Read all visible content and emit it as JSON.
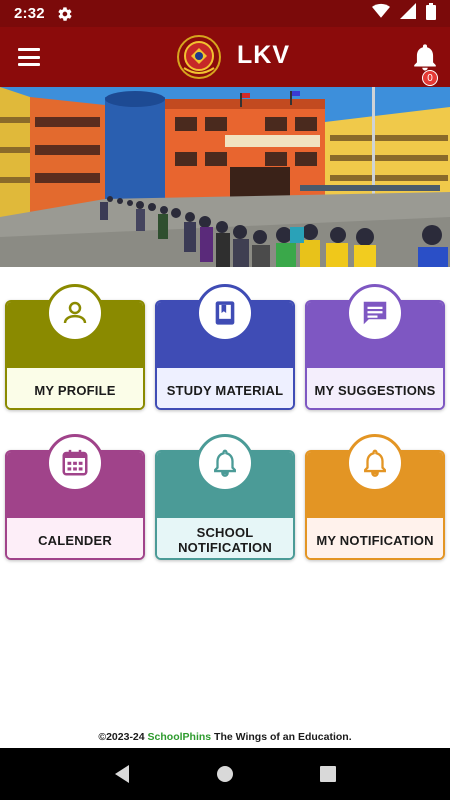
{
  "status_bar": {
    "time": "2:32",
    "icons": [
      "gear-icon",
      "wifi-icon",
      "signal-icon",
      "battery-icon"
    ]
  },
  "app_bar": {
    "title": "LKV",
    "menu_icon": "hamburger-menu-icon",
    "notification_icon": "bell-icon",
    "notification_count": "0",
    "background_color": "#8b0b0b"
  },
  "hero": {
    "description_icon": "school-building-photo"
  },
  "tiles": [
    {
      "label": "MY PROFILE",
      "icon": "person-icon",
      "accent": "#8a8a00",
      "bottom_bg": "#fbfde8"
    },
    {
      "label": "STUDY MATERIAL",
      "icon": "book-icon",
      "accent": "#3f4cb5",
      "bottom_bg": "#eef0ff"
    },
    {
      "label": "MY SUGGESTIONS",
      "icon": "chat-icon",
      "accent": "#7e57c2",
      "bottom_bg": "#f4eefc"
    },
    {
      "label": "CALENDER",
      "icon": "calendar-icon",
      "accent": "#a0438a",
      "bottom_bg": "#fdeef8"
    },
    {
      "label_line1": "SCHOOL",
      "label_line2": "NOTIFICATION",
      "icon": "bell-icon",
      "accent": "#4b9b97",
      "bottom_bg": "#e6f6f7"
    },
    {
      "label": "MY NOTIFICATION",
      "icon": "bell-icon",
      "accent": "#e39524",
      "bottom_bg": "#fff2ec"
    }
  ],
  "footer": {
    "prefix": "©2023-24 ",
    "brand": "SchoolPhins",
    "suffix": " The Wings of an Education."
  },
  "nav_bar": {
    "icons": [
      "back-icon",
      "home-icon",
      "recents-icon"
    ]
  }
}
